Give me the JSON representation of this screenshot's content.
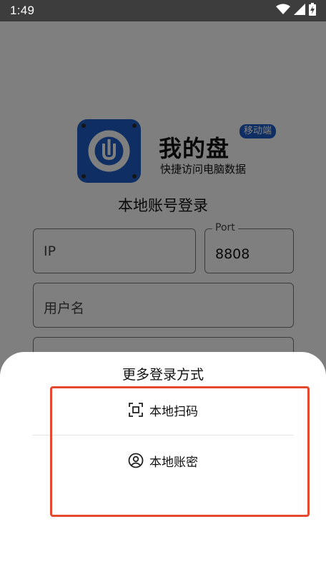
{
  "status_bar": {
    "time": "1:49",
    "icons": [
      "wifi-icon",
      "signal-icon",
      "battery-icon"
    ]
  },
  "app": {
    "title": "我的盘",
    "badge": "移动端",
    "subtitle": "快捷访问电脑数据",
    "brand_color": "#1f5fc9"
  },
  "login": {
    "heading": "本地账号登录",
    "ip_placeholder": "IP",
    "port_label": "Port",
    "port_value": "8808",
    "username_placeholder": "用户名"
  },
  "sheet": {
    "title": "更多登录方式",
    "options": [
      {
        "label": "本地扫码",
        "icon": "scan-icon"
      },
      {
        "label": "本地账密",
        "icon": "user-icon"
      }
    ],
    "highlight_color": "#e4492f"
  }
}
